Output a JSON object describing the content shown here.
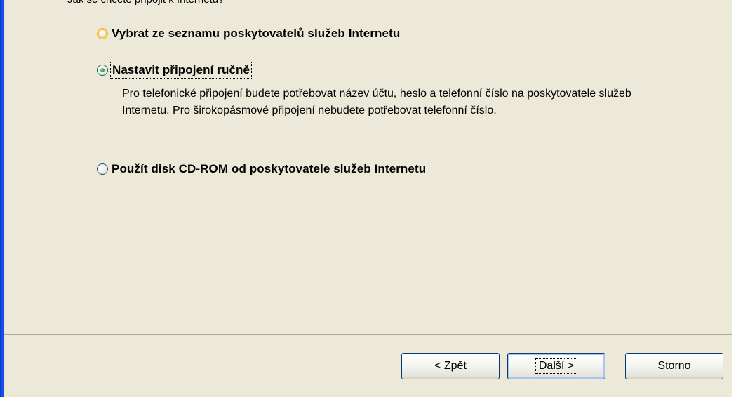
{
  "wizard": {
    "question": "Jak se chcete připojit k Internetu?",
    "options": [
      {
        "label": "Vybrat ze seznamu poskytovatelů služeb Internetu",
        "selected": false
      },
      {
        "label": "Nastavit připojení ručně",
        "selected": true
      },
      {
        "label": "Použít disk CD-ROM od poskytovatele služeb Internetu",
        "selected": false
      }
    ],
    "manual_description": "Pro telefonické připojení budete potřebovat název účtu, heslo a telefonní číslo na poskytovatele služeb Internetu. Pro širokopásmové připojení nebudete potřebovat telefonní číslo."
  },
  "buttons": {
    "back": "< Zpět",
    "next": "Další >",
    "cancel": "Storno"
  },
  "colors": {
    "dialog_background": "#ece9d8",
    "window_frame": "#0831d9",
    "radio_hover": "#f8b32c",
    "radio_selected_dot": "#21a121"
  },
  "icons": {
    "radio_unselected": "radio-off-icon",
    "radio_selected": "radio-on-icon"
  }
}
